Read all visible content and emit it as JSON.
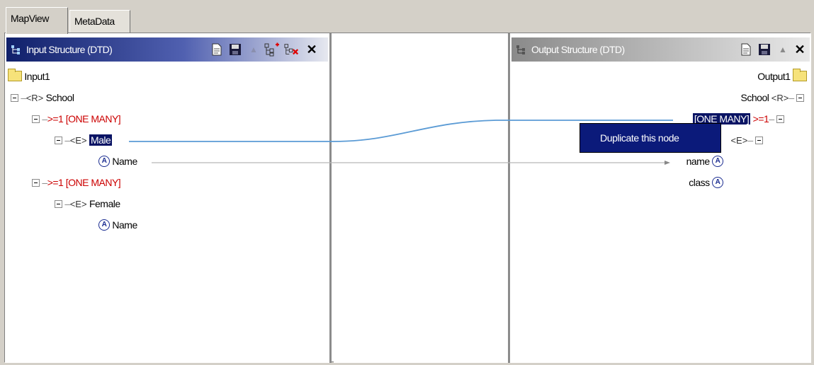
{
  "tabs": [
    {
      "label": "MapView",
      "active": true
    },
    {
      "label": "MetaData",
      "active": false
    }
  ],
  "input_panel": {
    "title": "Input Structure (DTD)",
    "buttons": [
      "document-icon",
      "save-icon",
      "up-arrow-icon",
      "add-node-icon",
      "delete-node-icon",
      "close-icon"
    ],
    "tree": {
      "root": "Input1",
      "school_tag": "<R>",
      "school": "School",
      "card1": ">=1",
      "card1_label": "[ONE MANY]",
      "male_tag": "<E>",
      "male": "Male",
      "attr_icon": "A",
      "male_name": "Name",
      "card2": ">=1",
      "card2_label": "[ONE MANY]",
      "female_tag": "<E>",
      "female": "Female",
      "female_name": "Name"
    }
  },
  "output_panel": {
    "title": "Output Structure (DTD)",
    "buttons": [
      "document-icon",
      "save-icon",
      "up-arrow-icon",
      "close-icon"
    ],
    "tree": {
      "root": "Output1",
      "school_tag": "<R>",
      "school": "School",
      "card_label": "[ONE MANY]",
      "card": ">=1",
      "elem_tag": "<E>",
      "attr_icon": "A",
      "attr1": "name",
      "attr2": "class"
    }
  },
  "context_menu": {
    "item": "Duplicate this node"
  },
  "colors": {
    "selection": "#0a1464",
    "cardinality": "#cc0000",
    "link_line": "#5b9bd5",
    "input_header": "#10206a"
  }
}
